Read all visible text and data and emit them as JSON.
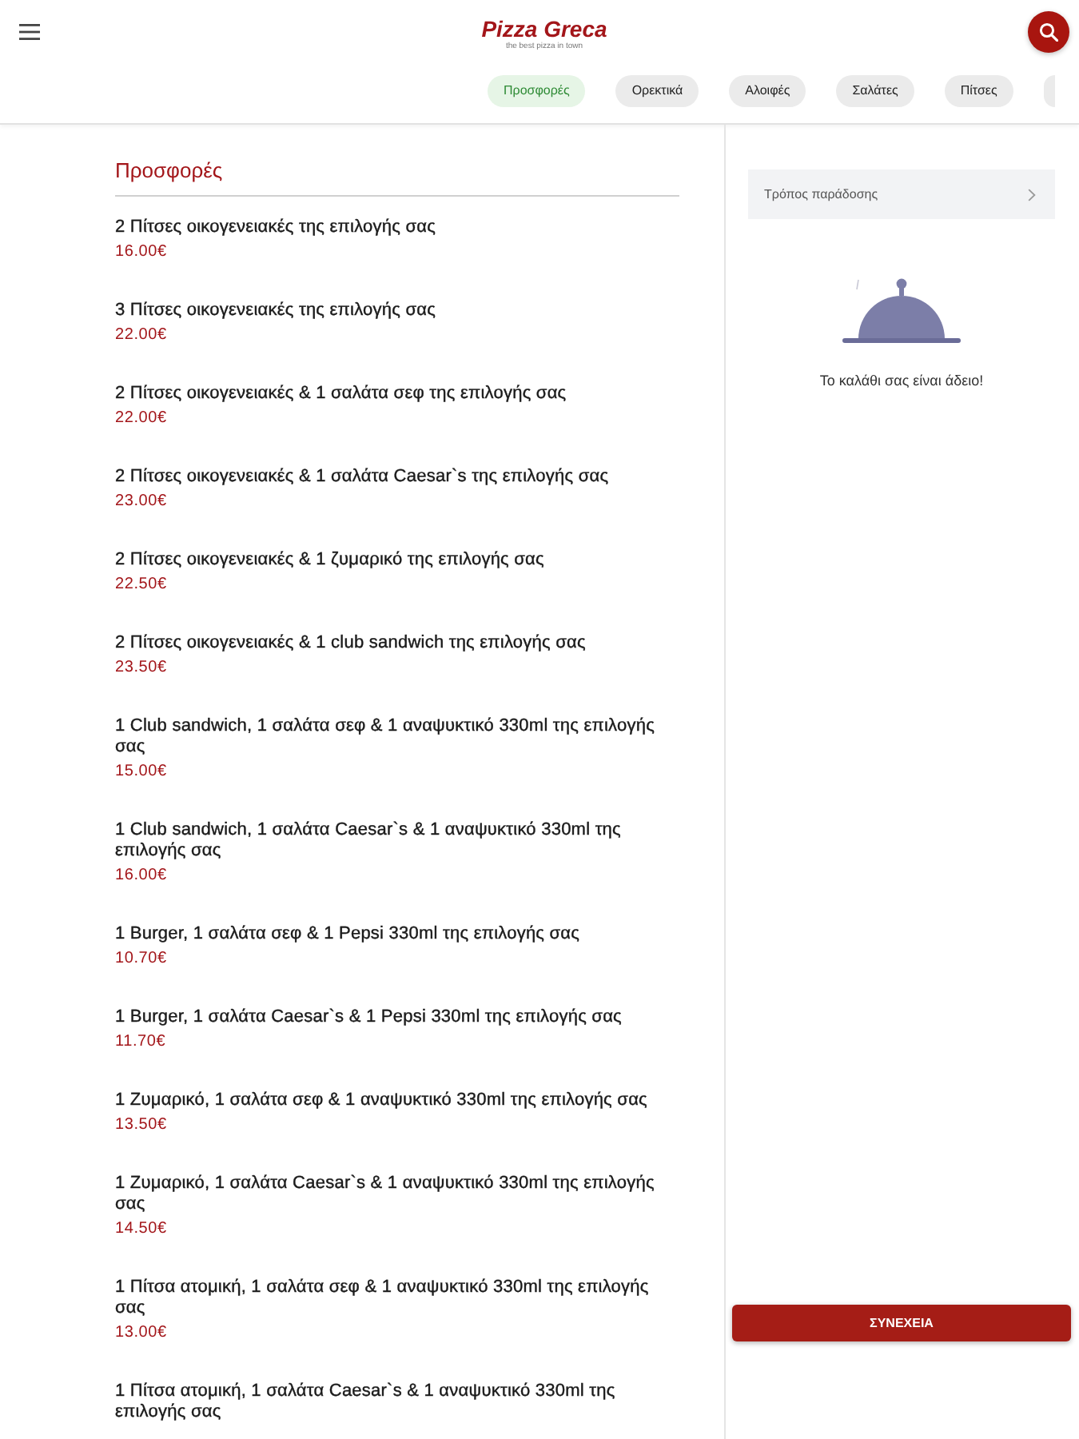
{
  "header": {
    "logo": "Pizza Greca",
    "tagline": "the best pizza in town"
  },
  "categories": [
    {
      "label": "Προσφορές",
      "selected": true
    },
    {
      "label": "Ορεκτικά",
      "selected": false
    },
    {
      "label": "Αλοιφές",
      "selected": false
    },
    {
      "label": "Σαλάτες",
      "selected": false
    },
    {
      "label": "Πίτσες",
      "selected": false
    }
  ],
  "section": {
    "title": "Προσφορές",
    "items": [
      {
        "name": "2 Πίτσες οικογενειακές της επιλογής σας",
        "price": "16.00€"
      },
      {
        "name": "3 Πίτσες οικογενειακές της επιλογής σας",
        "price": "22.00€"
      },
      {
        "name": "2 Πίτσες οικογενειακές & 1 σαλάτα σεφ της επιλογής σας",
        "price": "22.00€"
      },
      {
        "name": "2 Πίτσες οικογενειακές & 1 σαλάτα Caesar`s της επιλογής σας",
        "price": "23.00€"
      },
      {
        "name": "2 Πίτσες οικογενειακές & 1 ζυμαρικό της επιλογής σας",
        "price": "22.50€"
      },
      {
        "name": "2 Πίτσες οικογενειακές & 1 club sandwich της επιλογής σας",
        "price": "23.50€"
      },
      {
        "name": "1 Club sandwich, 1 σαλάτα σεφ & 1 αναψυκτικό 330ml της επιλογής σας",
        "price": "15.00€"
      },
      {
        "name": "1 Club sandwich, 1 σαλάτα Caesar`s & 1 αναψυκτικό 330ml της επιλογής σας",
        "price": "16.00€"
      },
      {
        "name": "1 Burger, 1 σαλάτα σεφ & 1 Pepsi 330ml της επιλογής σας",
        "price": "10.70€"
      },
      {
        "name": "1 Burger, 1 σαλάτα Caesar`s & 1 Pepsi 330ml της επιλογής σας",
        "price": "11.70€"
      },
      {
        "name": "1 Ζυμαρικό, 1 σαλάτα σεφ & 1 αναψυκτικό 330ml της επιλογής σας",
        "price": "13.50€"
      },
      {
        "name": "1 Ζυμαρικό, 1 σαλάτα Caesar`s & 1 αναψυκτικό 330ml της επιλογής σας",
        "price": "14.50€"
      },
      {
        "name": "1 Πίτσα ατομική, 1 σαλάτα σεφ & 1 αναψυκτικό 330ml της επιλογής σας",
        "price": "13.00€"
      },
      {
        "name": "1 Πίτσα ατομική, 1 σαλάτα Caesar`s & 1 αναψυκτικό 330ml της επιλογής σας"
      }
    ]
  },
  "cart": {
    "delivery_label": "Τρόπος παράδοσης",
    "empty_message": "Το καλάθι σας είναι άδειο!",
    "button": "ΣΥΝΕΧΕΙΑ"
  }
}
